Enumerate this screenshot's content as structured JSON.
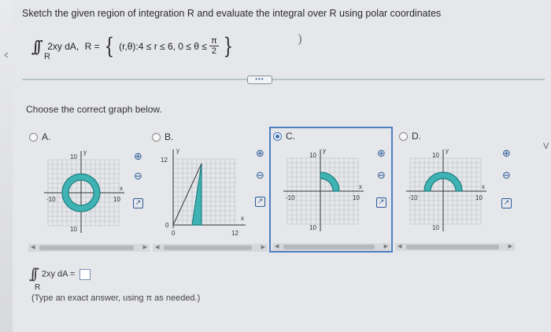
{
  "question": {
    "prompt": "Sketch the given region of integration R and evaluate the integral over R using polar coordinates",
    "integrand": "2xy dA,",
    "region_label": "R =",
    "region_conditions": "(r,θ):4 ≤ r ≤ 6, 0 ≤ θ ≤",
    "theta_upper_num": "π",
    "theta_upper_den": "2",
    "region_subscript": "R"
  },
  "more_button_label": "•••",
  "instruction": "Choose the correct graph below.",
  "options": [
    {
      "letter": "A.",
      "selected": false,
      "tick_top": "10",
      "tick_bottom": "10",
      "tick_left": "-10",
      "tick_right": "10",
      "x_label": "x",
      "y_label": "y"
    },
    {
      "letter": "B.",
      "selected": false,
      "tick_top": "12",
      "tick_bottom": "0",
      "tick_left": "0",
      "tick_right": "12",
      "x_label": "x",
      "y_label": "y"
    },
    {
      "letter": "C.",
      "selected": true,
      "tick_top": "10",
      "tick_bottom": "10",
      "tick_left": "-10",
      "tick_right": "10",
      "x_label": "x",
      "y_label": "y"
    },
    {
      "letter": "D.",
      "selected": false,
      "tick_top": "10",
      "tick_bottom": "10",
      "tick_left": "-10",
      "tick_right": "10",
      "x_label": "x",
      "y_label": "y"
    }
  ],
  "icons": {
    "zoom_in": "zoom-in-icon",
    "zoom_out": "zoom-out-icon",
    "popout": "popout-icon"
  },
  "answer": {
    "expression": "2xy dA =",
    "subscript": "R",
    "value": ""
  },
  "hint": "(Type an exact answer, using π as needed.)",
  "edge_char": "V",
  "colors": {
    "region_fill": "#3fb3b3",
    "region_stroke": "#1f7f82",
    "grid": "#b9bcc2",
    "selection": "#4f7fc2",
    "icon": "#2f5b99"
  }
}
